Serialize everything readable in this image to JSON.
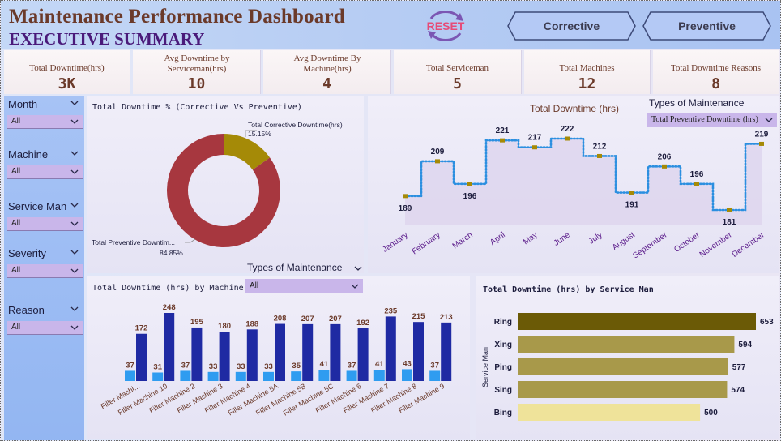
{
  "header": {
    "title": "Maintenance Performance Dashboard",
    "subtitle": "EXECUTIVE SUMMARY",
    "reset_label": "RESET",
    "buttons": {
      "corrective": "Corrective",
      "preventive": "Preventive"
    },
    "colors": {
      "title": "#6b3a2a",
      "subtitle": "#4a1a7a",
      "reset": "#e64b78"
    },
    "icons": {
      "reset": "refresh-arrows-icon"
    }
  },
  "kpis": [
    {
      "label": "Total Downtime(hrs)",
      "value": "3K"
    },
    {
      "label": "Avg Downtime by Serviceman(hrs)",
      "value": "10"
    },
    {
      "label": "Avg Downtime By Machine(hrs)",
      "value": "4"
    },
    {
      "label": "Total Serviceman",
      "value": "5"
    },
    {
      "label": "Total Machines",
      "value": "12"
    },
    {
      "label": "Total Downtime Reasons",
      "value": "8"
    }
  ],
  "filters": [
    {
      "title": "Month",
      "value": "All"
    },
    {
      "title": "Machine",
      "value": "All"
    },
    {
      "title": "Service Man",
      "value": "All"
    },
    {
      "title": "Severity",
      "value": "All"
    },
    {
      "title": "Reason",
      "value": "All"
    }
  ],
  "type_slicer_top": {
    "title": "Types of Maintenance",
    "value": "Total Preventive Downtime (hrs)"
  },
  "type_slicer_mid": {
    "title": "Types of Maintenance",
    "value": "All"
  },
  "chart_data": [
    {
      "type": "pie",
      "title": "Total Downtime % (Corrective Vs Preventive)",
      "slices": [
        {
          "label": "Total Corrective Downtime(hrs)",
          "value": 15.15,
          "display": "15.15%",
          "color": "#a58a07"
        },
        {
          "label": "Total Preventive Downtim...",
          "value": 84.85,
          "display": "84.85%",
          "color": "#a7373f"
        }
      ]
    },
    {
      "type": "line",
      "title": "Total Downtime (hrs)",
      "categories": [
        "January",
        "February",
        "March",
        "April",
        "May",
        "June",
        "July",
        "August",
        "September",
        "October",
        "November",
        "December"
      ],
      "values": [
        189,
        209,
        196,
        221,
        217,
        222,
        212,
        191,
        206,
        196,
        181,
        219
      ],
      "line_color": "#2b8fe0",
      "marker_color": "#a58a07"
    },
    {
      "type": "bar",
      "title": "Total Downtime (hrs) by Machine",
      "categories": [
        "Filler Machi...",
        "Filler Machine 10",
        "Filler Machine 2",
        "Filler Machine 3",
        "Filler Machine 4",
        "Filler Machine 5A",
        "Filler Machine 5B",
        "Filler Machine 5C",
        "Filler Machine 6",
        "Filler Machine 7",
        "Filler Machine 8",
        "Filler Machine 9"
      ],
      "series": [
        {
          "values": [
            37,
            31,
            37,
            33,
            33,
            33,
            35,
            41,
            37,
            41,
            43,
            37
          ],
          "color": "#2f9cf0"
        },
        {
          "values": [
            172,
            248,
            195,
            180,
            188,
            208,
            207,
            207,
            192,
            235,
            215,
            213
          ],
          "color": "#1f2aa3"
        }
      ],
      "ylim": [
        0,
        260
      ]
    },
    {
      "type": "bar",
      "orientation": "horizontal",
      "title": "Total Downtime (hrs) by Service Man",
      "ylabel": "Service Man",
      "categories": [
        "Ring",
        "Xing",
        "Ping",
        "Sing",
        "Bing"
      ],
      "values": [
        653,
        594,
        577,
        574,
        500
      ],
      "colors": [
        "#6b5a06",
        "#a8994a",
        "#a8994a",
        "#a8994a",
        "#efe39a"
      ],
      "xlim": [
        0,
        680
      ]
    }
  ]
}
